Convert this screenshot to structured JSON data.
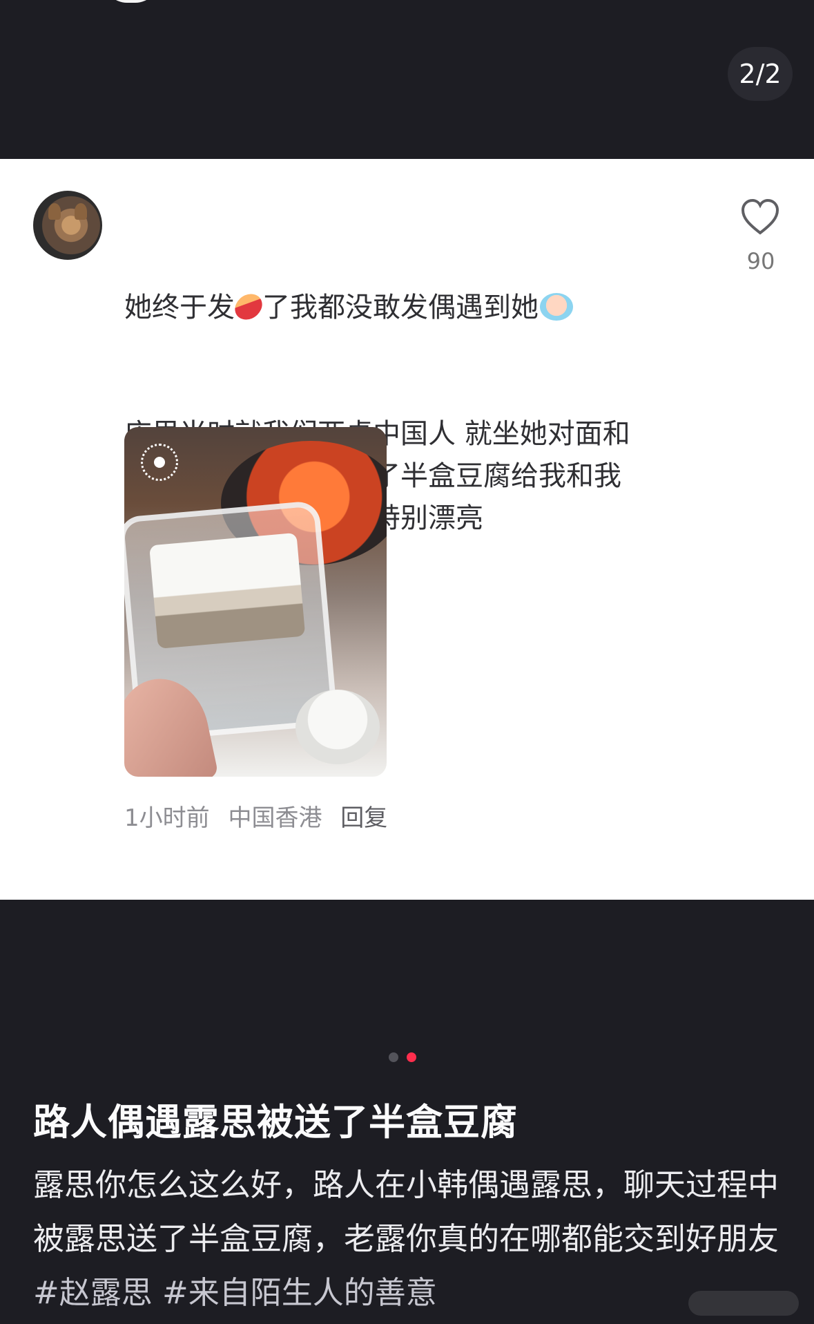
{
  "top": {
    "page_indicator": "2/2"
  },
  "comment": {
    "text_line1_prefix": "她终于发",
    "text_line1_middle": "了我都没敢发偶遇到她",
    "text_rest": "店里当时就我们两桌中国人 就坐她对面和\n我们聊了好几句还分了半盒豆腐给我和我\n朋友吃真的特别特别特别漂亮",
    "like_count": "90",
    "meta": {
      "time": "1小时前",
      "location": "中国香港",
      "reply_label": "回复"
    },
    "emojis": [
      "sweet-potato-emoji",
      "crying-baby-emoji"
    ],
    "photo_icon": "live-photo-icon",
    "like_icon": "heart-outline-icon"
  },
  "post": {
    "title": "路人偶遇露思被送了半盒豆腐",
    "body_text": "露思你怎么这么好，路人在小韩偶遇露思，聊天过程中被露思送了半盒豆腐，老露你真的在哪都能交到好朋友",
    "hashtags": [
      "#赵露思",
      "#来自陌生人的善意"
    ]
  },
  "carousel": {
    "current_index": 2,
    "total": 2
  },
  "colors": {
    "background": "#1d1d23",
    "card": "#ffffff",
    "accent_dot": "#ff2e4d"
  }
}
